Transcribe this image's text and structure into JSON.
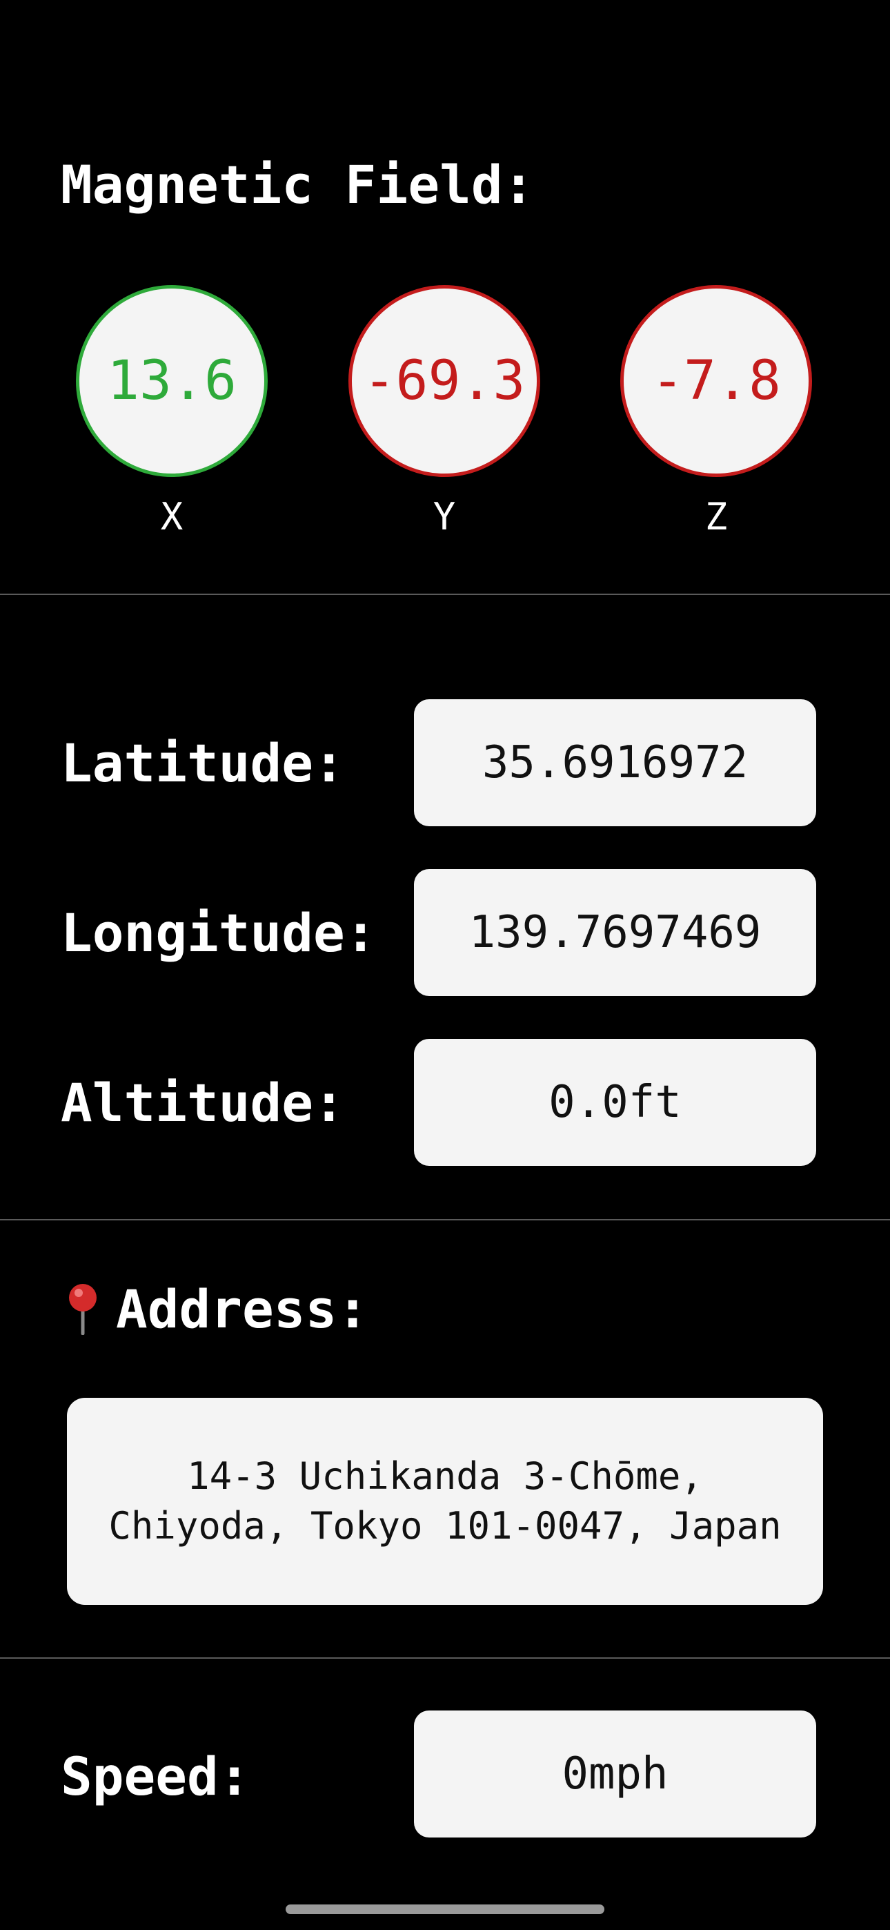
{
  "magnetic_field": {
    "title": "Magnetic Field:",
    "axes": [
      {
        "label": "X",
        "value": "13.6",
        "status": "ok",
        "color": "#2eaa3a"
      },
      {
        "label": "Y",
        "value": "-69.3",
        "status": "bad",
        "color": "#c41c1c"
      },
      {
        "label": "Z",
        "value": "-7.8",
        "status": "bad",
        "color": "#c41c1c"
      }
    ]
  },
  "location": {
    "latitude_label": "Latitude:",
    "latitude_value": "35.6916972",
    "longitude_label": "Longitude:",
    "longitude_value": "139.7697469",
    "altitude_label": "Altitude:",
    "altitude_value": "0.0ft"
  },
  "address": {
    "icon": "pushpin-icon",
    "title": "Address:",
    "line1": "14-3 Uchikanda 3-Chōme,",
    "line2": "Chiyoda, Tokyo 101-0047, Japan"
  },
  "speed": {
    "label": "Speed:",
    "value": "0mph"
  }
}
